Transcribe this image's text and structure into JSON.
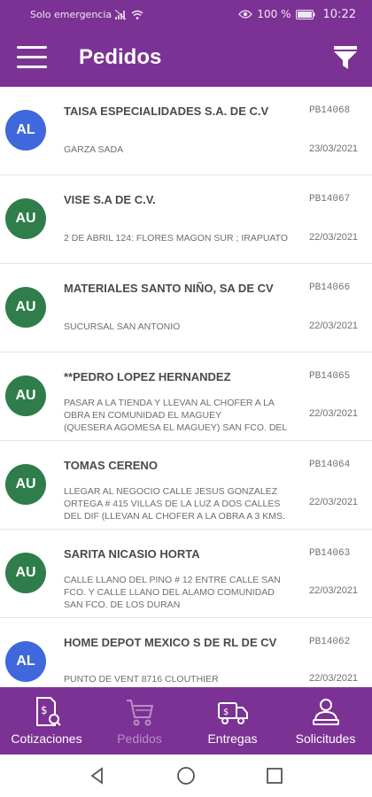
{
  "status_bar": {
    "carrier": "Solo emergencia",
    "battery": "100 %",
    "time": "10:22"
  },
  "app_bar": {
    "title": "Pedidos"
  },
  "orders": [
    {
      "initials": "AL",
      "avatar_color": "#3f68dd",
      "name": "TAISA ESPECIALIDADES S.A. DE C.V",
      "code": "PB14068",
      "address_lines": [
        "GARZA SADA"
      ],
      "date": "23/03/2021"
    },
    {
      "initials": "AU",
      "avatar_color": "#2e7d4a",
      "name": "VISE S.A DE C.V.",
      "code": "PB14067",
      "address_lines": [
        "2 DE ABRIL 124: FLORES MAGON SUR ; IRAPUATO"
      ],
      "date": "22/03/2021"
    },
    {
      "initials": "AU",
      "avatar_color": "#2e7d4a",
      "name": "MATERIALES SANTO NIÑO, SA DE CV",
      "code": "PB14066",
      "address_lines": [
        "SUCURSAL SAN ANTONIO"
      ],
      "date": "22/03/2021"
    },
    {
      "initials": "AU",
      "avatar_color": "#2e7d4a",
      "name": "**PEDRO LOPEZ HERNANDEZ",
      "code": "PB14065",
      "address_lines": [
        "PASAR A LA TIENDA Y LLEVAN AL CHOFER A LA",
        "OBRA EN COMUNIDAD EL MAGUEY",
        "(QUESERA AGOMESA EL MAGUEY) SAN FCO. DEL"
      ],
      "date": "22/03/2021"
    },
    {
      "initials": "AU",
      "avatar_color": "#2e7d4a",
      "name": "TOMAS CERENO",
      "code": "PB14064",
      "address_lines": [
        "LLEGAR AL NEGOCIO CALLE JESUS GONZALEZ",
        "ORTEGA # 415 VILLAS DE LA LUZ A DOS CALLES",
        "DEL DIF (LLEVAN AL CHOFER A LA OBRA A 3 KMS."
      ],
      "date": "22/03/2021"
    },
    {
      "initials": "AU",
      "avatar_color": "#2e7d4a",
      "name": "SARITA NICASIO HORTA",
      "code": "PB14063",
      "address_lines": [
        "CALLE LLANO DEL PINO # 12 ENTRE CALLE SAN",
        "FCO. Y CALLE LLANO DEL ALAMO COMUNIDAD",
        "SAN FCO. DE LOS DURAN"
      ],
      "date": "22/03/2021"
    },
    {
      "initials": "AL",
      "avatar_color": "#3f68dd",
      "name": "HOME DEPOT MEXICO S DE RL DE CV",
      "code": "PB14062",
      "address_lines": [
        "PUNTO DE VENT 8716 CLOUTHIER"
      ],
      "date": "22/03/2021"
    }
  ],
  "bottom_nav": [
    {
      "label": "Cotizaciones",
      "icon": "quote-document-icon",
      "active": true
    },
    {
      "label": "Pedidos",
      "icon": "cart-icon",
      "active": false
    },
    {
      "label": "Entregas",
      "icon": "delivery-truck-icon",
      "active": true
    },
    {
      "label": "Solicitudes",
      "icon": "user-request-icon",
      "active": true
    }
  ],
  "colors": {
    "primary": "#7b3294",
    "avatar_blue": "#3f68dd",
    "avatar_green": "#2e7d4a"
  }
}
